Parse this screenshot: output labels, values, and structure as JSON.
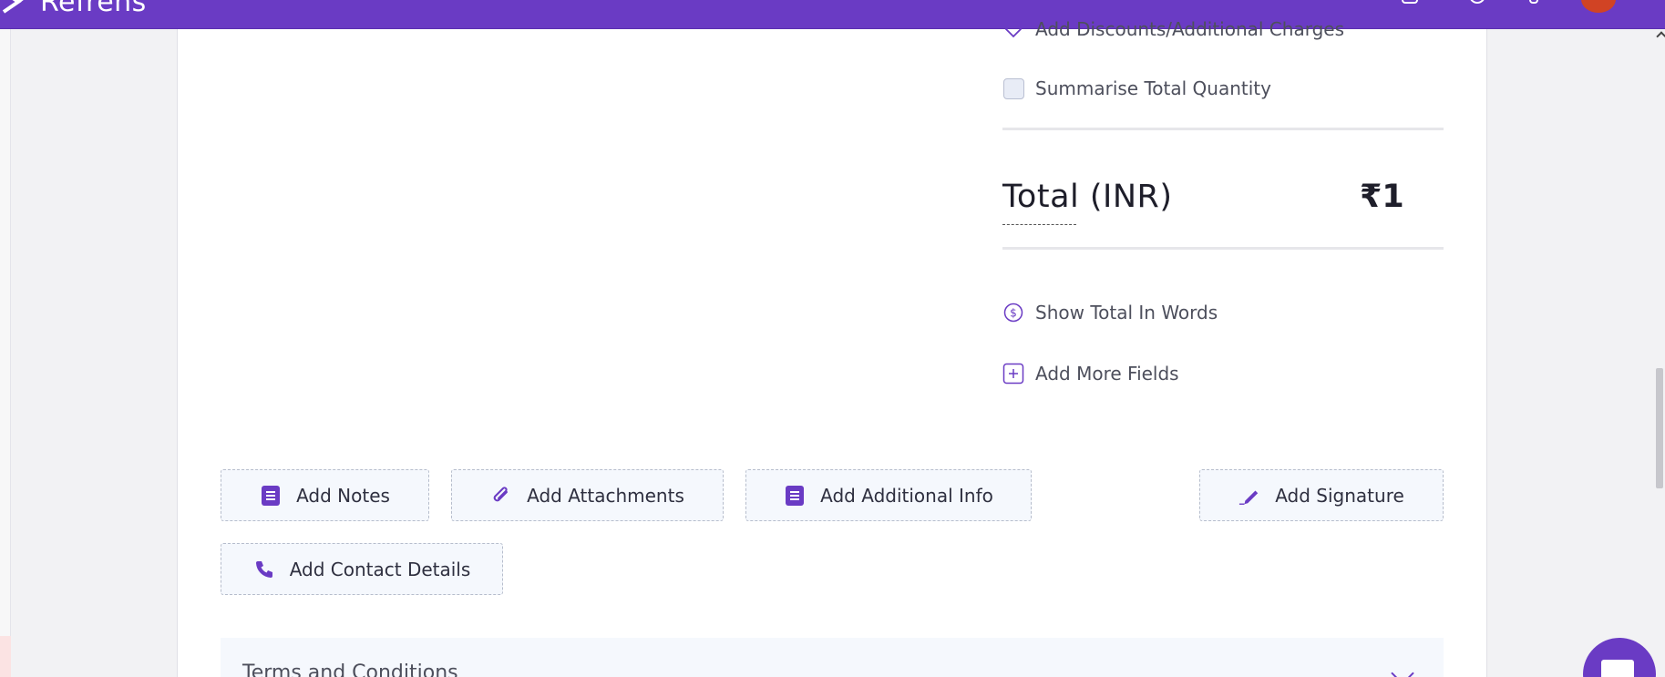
{
  "header": {
    "app_name": "Refrens"
  },
  "summary": {
    "discounts_label": "Add Discounts/Additional Charges",
    "summarise_label": "Summarise Total Quantity",
    "summarise_checked": false,
    "total_label": "Total (INR)",
    "total_amount": "₹1",
    "show_total_words_label": "Show Total In Words",
    "add_more_fields_label": "Add More Fields"
  },
  "actions": {
    "add_notes": "Add Notes",
    "add_attachments": "Add Attachments",
    "add_additional_info": "Add Additional Info",
    "add_signature": "Add Signature",
    "add_contact_details": "Add Contact Details"
  },
  "terms": {
    "title": "Terms and Conditions"
  },
  "colors": {
    "brand": "#6a3bc4",
    "button_bg": "#f5f8fd"
  }
}
